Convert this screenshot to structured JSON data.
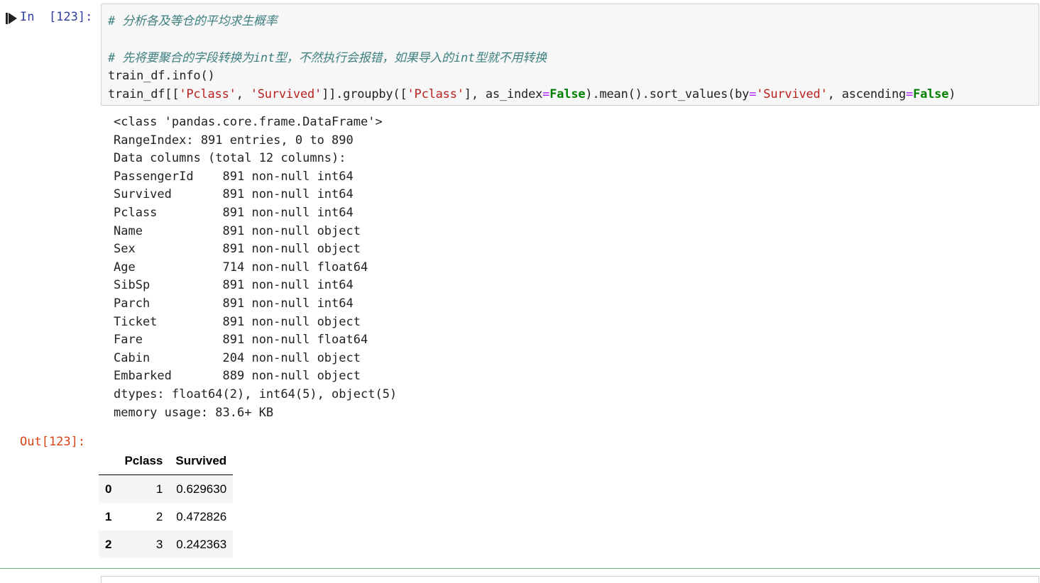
{
  "cell_in": {
    "prompt": "In  [123]:",
    "lines": [
      [
        {
          "t": "# 分析各及等仓的平均求生概率",
          "c": "cmt"
        }
      ],
      [],
      [
        {
          "t": "# 先将要聚合的字段转换为int型，不然执行会报错，如果导入的int型就不用转换",
          "c": "cmt"
        }
      ],
      [
        {
          "t": "train_df",
          "c": ""
        },
        {
          "t": ".",
          "c": ""
        },
        {
          "t": "info",
          "c": ""
        },
        {
          "t": "()",
          "c": ""
        }
      ],
      [
        {
          "t": "train_df[[",
          "c": ""
        },
        {
          "t": "'Pclass'",
          "c": "str"
        },
        {
          "t": ", ",
          "c": ""
        },
        {
          "t": "'Survived'",
          "c": "str"
        },
        {
          "t": "]].groupby([",
          "c": ""
        },
        {
          "t": "'Pclass'",
          "c": "str"
        },
        {
          "t": "], as_index",
          "c": ""
        },
        {
          "t": "=",
          "c": "op"
        },
        {
          "t": "False",
          "c": "kw"
        },
        {
          "t": ").mean().sort_values(by",
          "c": ""
        },
        {
          "t": "=",
          "c": "op"
        },
        {
          "t": "'Survived'",
          "c": "str"
        },
        {
          "t": ", ascending",
          "c": ""
        },
        {
          "t": "=",
          "c": "op"
        },
        {
          "t": "False",
          "c": "kw"
        },
        {
          "t": ")",
          "c": ""
        }
      ]
    ]
  },
  "stdout": [
    "<class 'pandas.core.frame.DataFrame'>",
    "RangeIndex: 891 entries, 0 to 890",
    "Data columns (total 12 columns):",
    "PassengerId    891 non-null int64",
    "Survived       891 non-null int64",
    "Pclass         891 non-null int64",
    "Name           891 non-null object",
    "Sex            891 non-null object",
    "Age            714 non-null float64",
    "SibSp          891 non-null int64",
    "Parch          891 non-null int64",
    "Ticket         891 non-null object",
    "Fare           891 non-null float64",
    "Cabin          204 non-null object",
    "Embarked       889 non-null object",
    "dtypes: float64(2), int64(5), object(5)",
    "memory usage: 83.6+ KB"
  ],
  "cell_out": {
    "prompt": "Out[123]:",
    "table": {
      "columns": [
        "",
        "Pclass",
        "Survived"
      ],
      "rows": [
        {
          "index": "0",
          "Pclass": "1",
          "Survived": "0.629630"
        },
        {
          "index": "1",
          "Pclass": "2",
          "Survived": "0.472826"
        },
        {
          "index": "2",
          "Pclass": "3",
          "Survived": "0.242363"
        }
      ]
    }
  },
  "icons": {
    "run": "step-forward-icon"
  },
  "colors": {
    "in_prompt": "#303F9F",
    "out_prompt": "#D84315",
    "comment": "#408080",
    "string": "#BA2121",
    "keyword": "#008000",
    "selected_border": "#66bb6a"
  }
}
